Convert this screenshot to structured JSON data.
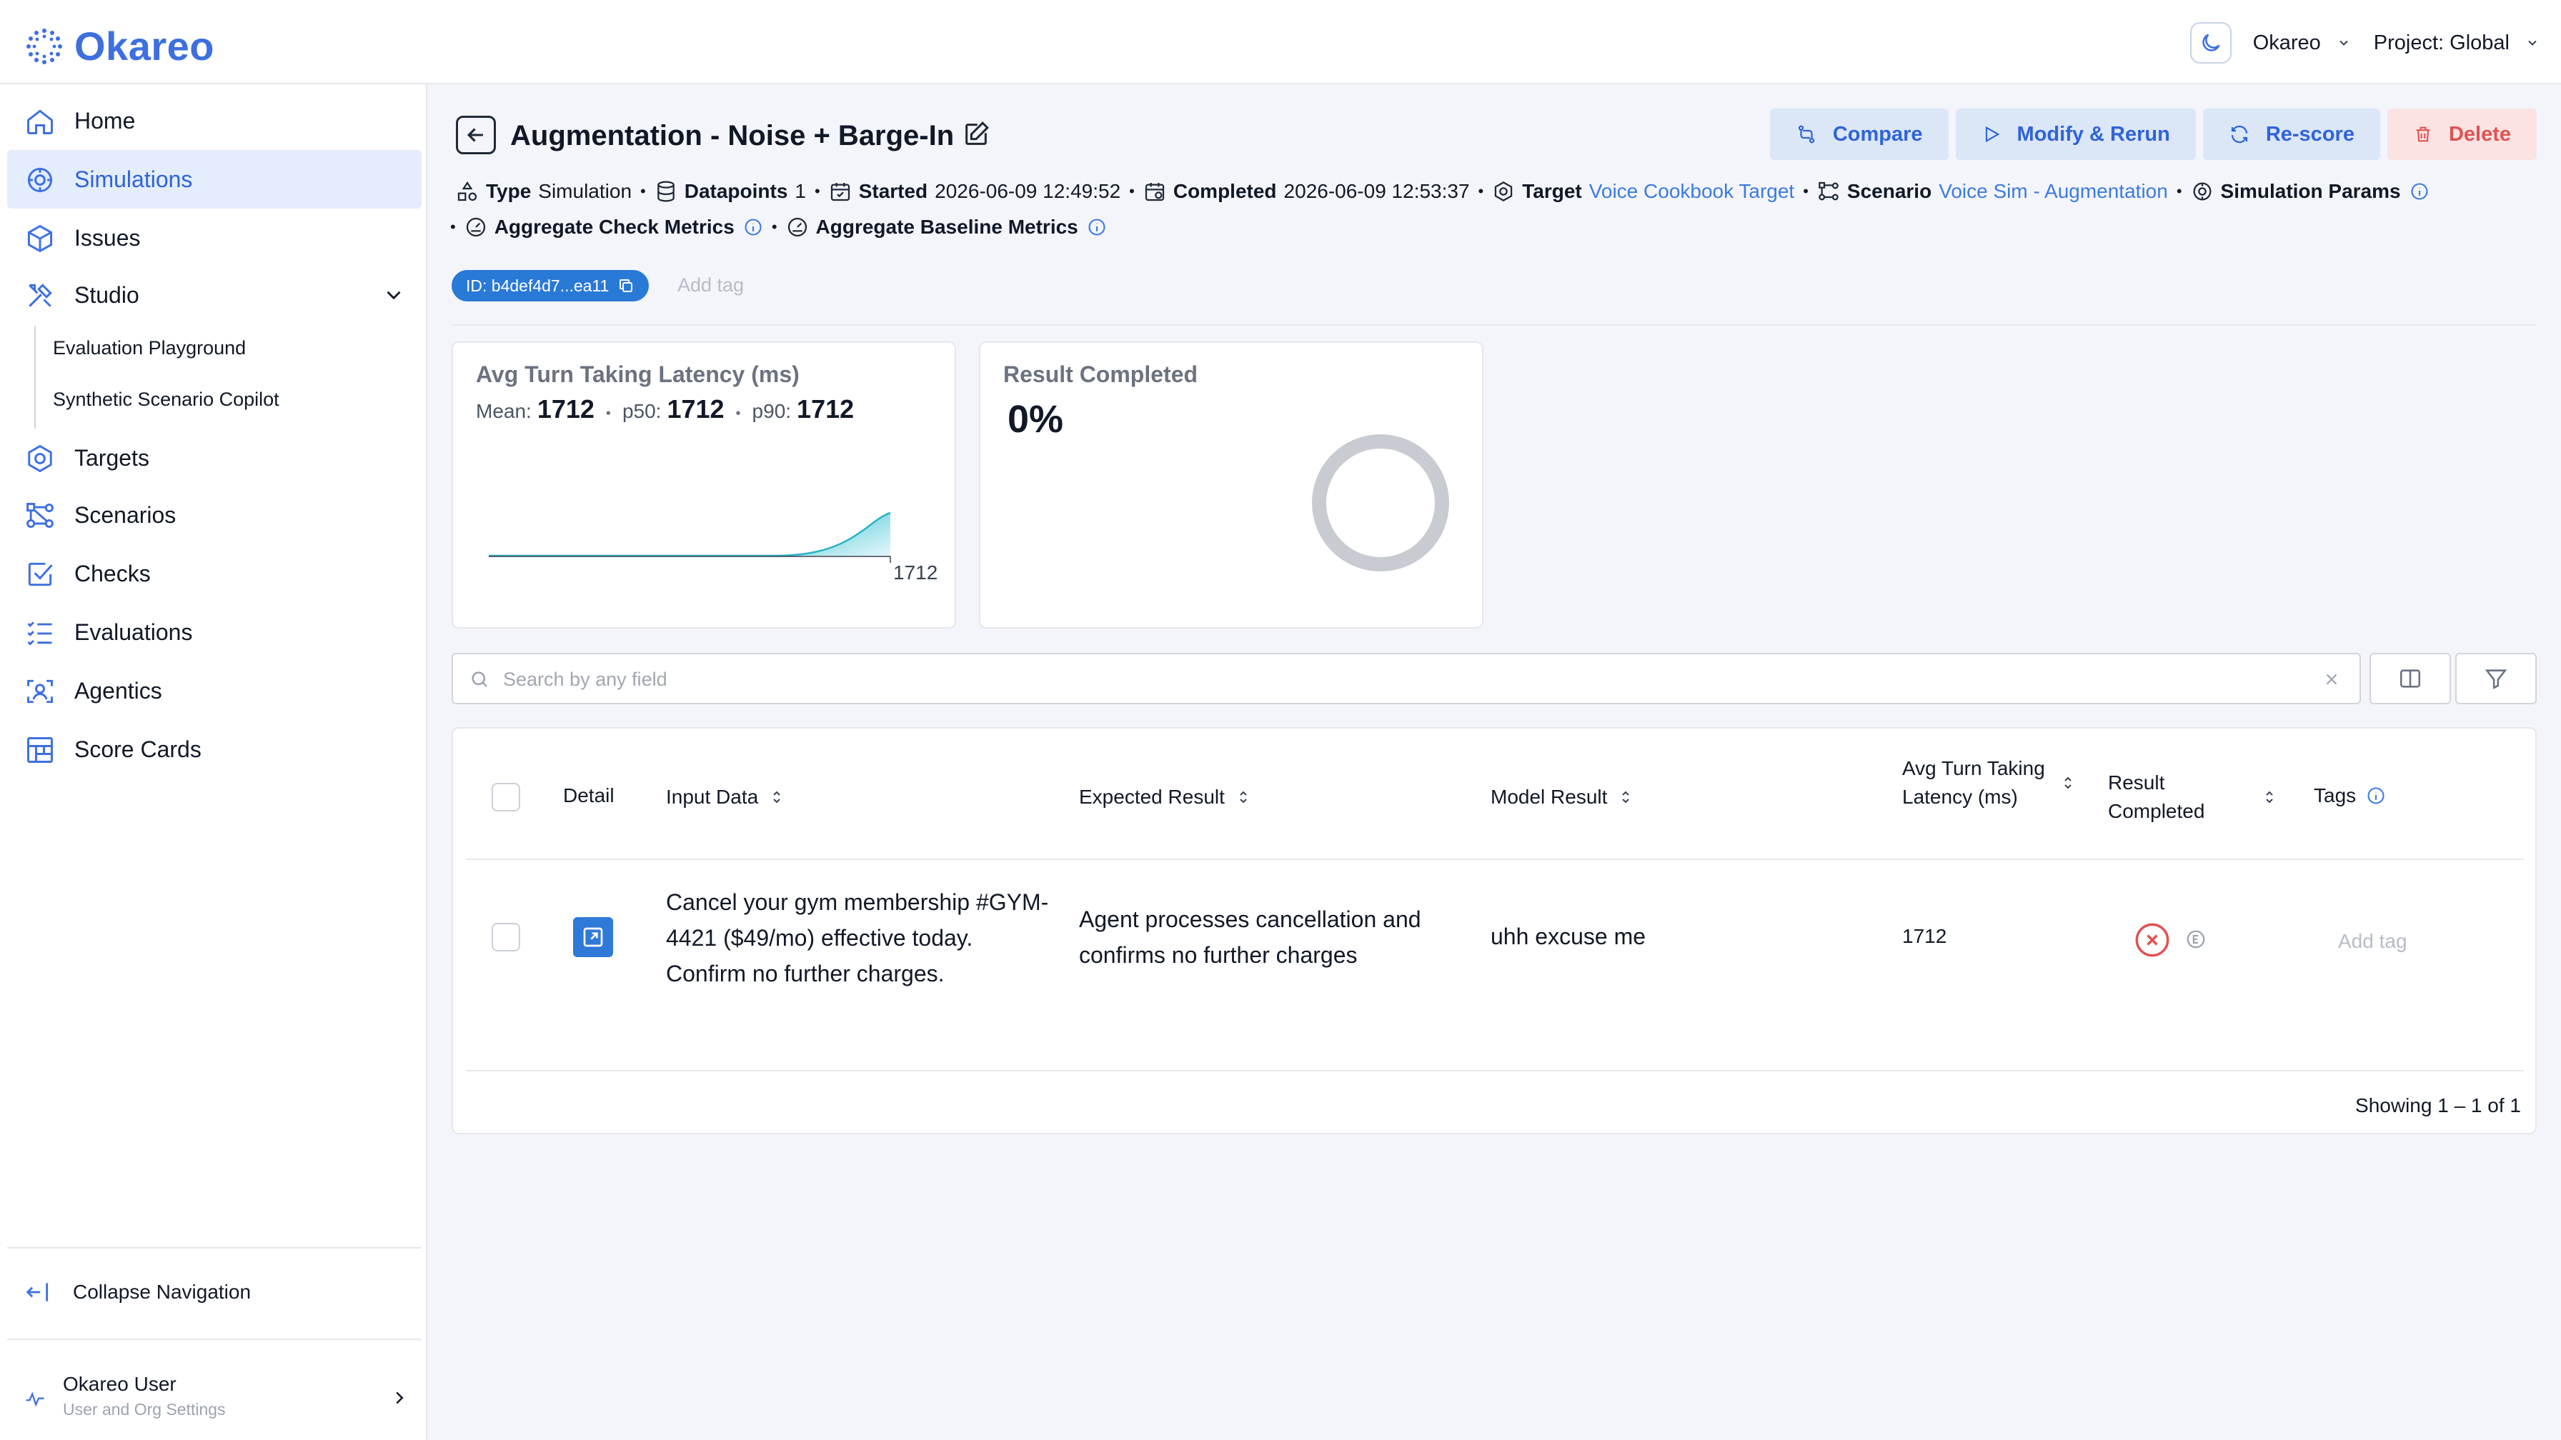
{
  "app": {
    "name": "Okareo",
    "org_selector": "Okareo",
    "project_selector": "Project: Global",
    "accent": "#3d6fe0"
  },
  "sidebar": {
    "items": [
      {
        "label": "Home",
        "icon": "home-icon"
      },
      {
        "label": "Simulations",
        "icon": "simulation-icon",
        "active": true
      },
      {
        "label": "Issues",
        "icon": "cube-icon"
      },
      {
        "label": "Studio",
        "icon": "tools-icon"
      },
      {
        "label": "Targets",
        "icon": "hexagon-icon"
      },
      {
        "label": "Scenarios",
        "icon": "flow-icon"
      },
      {
        "label": "Checks",
        "icon": "checkbox-icon"
      },
      {
        "label": "Evaluations",
        "icon": "list-check-icon"
      },
      {
        "label": "Agentics",
        "icon": "agent-scan-icon"
      },
      {
        "label": "Score Cards",
        "icon": "table-icon"
      }
    ],
    "studio_subitems": [
      "Evaluation Playground",
      "Synthetic Scenario Copilot"
    ],
    "collapse_label": "Collapse Navigation",
    "user": {
      "name": "Okareo User",
      "subtitle": "User and Org Settings"
    }
  },
  "header": {
    "title": "Augmentation - Noise + Barge-In",
    "actions": {
      "compare": "Compare",
      "modify": "Modify & Rerun",
      "rescore": "Re-score",
      "delete": "Delete"
    }
  },
  "meta": {
    "type_label": "Type",
    "type_value": "Simulation",
    "datapoints_label": "Datapoints",
    "datapoints_value": "1",
    "started_label": "Started",
    "started_value": "2026-06-09 12:49:52",
    "completed_label": "Completed",
    "completed_value": "2026-06-09 12:53:37",
    "target_label": "Target",
    "target_value": "Voice Cookbook Target",
    "scenario_label": "Scenario",
    "scenario_value": "Voice Sim - Augmentation",
    "sim_params_label": "Simulation Params",
    "agg_check_label": "Aggregate Check Metrics",
    "agg_baseline_label": "Aggregate Baseline Metrics"
  },
  "tags": {
    "id_pill": "ID: b4def4d7...ea11",
    "add_tag": "Add tag"
  },
  "cards": {
    "latency": {
      "title": "Avg Turn Taking Latency (ms)",
      "mean_label": "Mean:",
      "mean_value": "1712",
      "p50_label": "p50:",
      "p50_value": "1712",
      "p90_label": "p90:",
      "p90_value": "1712",
      "axis_label": "1712"
    },
    "result": {
      "title": "Result Completed",
      "value": "0%",
      "completed_fraction": 0
    }
  },
  "search": {
    "placeholder": "Search by any field"
  },
  "table": {
    "headers": {
      "detail": "Detail",
      "input": "Input Data",
      "expected": "Expected Result",
      "model": "Model Result",
      "latency": "Avg Turn Taking Latency (ms)",
      "result": "Result Completed",
      "tags": "Tags"
    },
    "rows": [
      {
        "input": "Cancel your gym membership #GYM-4421 ($49/mo) effective today. Confirm no further charges.",
        "expected": "Agent processes cancellation and confirms no further charges",
        "model": "uhh excuse me",
        "latency": "1712",
        "add_tag": "Add tag"
      }
    ],
    "showing": "Showing 1 – 1 of 1"
  }
}
